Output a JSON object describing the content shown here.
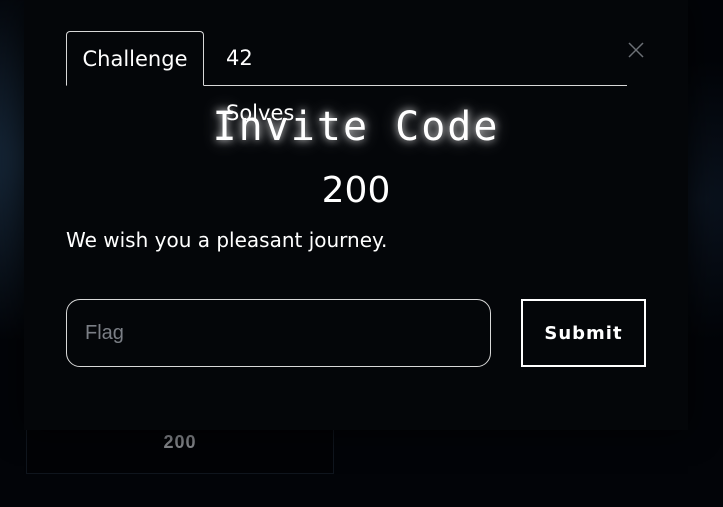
{
  "background_card": {
    "value": "200"
  },
  "modal": {
    "tabs": [
      {
        "label": "Challenge",
        "active": true
      },
      {
        "label": "42 Solves",
        "active": false
      }
    ],
    "title": "Invite Code",
    "points": "200",
    "description": "We wish you a pleasant journey.",
    "flag_input": {
      "placeholder": "Flag",
      "value": ""
    },
    "submit_label": "Submit",
    "close_icon": "close-icon"
  },
  "colors": {
    "background": "#020408",
    "modal_background": "#040609",
    "text": "#ffffff",
    "border": "#d8d8d8",
    "muted_text": "#8a8d92"
  }
}
